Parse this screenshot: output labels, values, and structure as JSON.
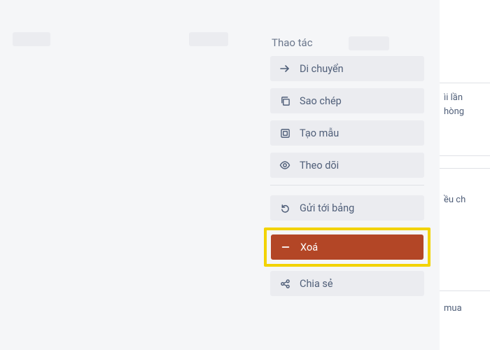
{
  "section_title": "Thao tác",
  "actions": {
    "move": "Di chuyển",
    "copy": "Sao chép",
    "template": "Tạo mẫu",
    "watch": "Theo dõi",
    "send_to_board": "Gửi tới bảng",
    "delete": "Xoá",
    "share": "Chia sẻ"
  },
  "background_text": {
    "line1": "ìi lần",
    "line2": "hòng",
    "line3": "ều ch",
    "line4": "mua"
  }
}
